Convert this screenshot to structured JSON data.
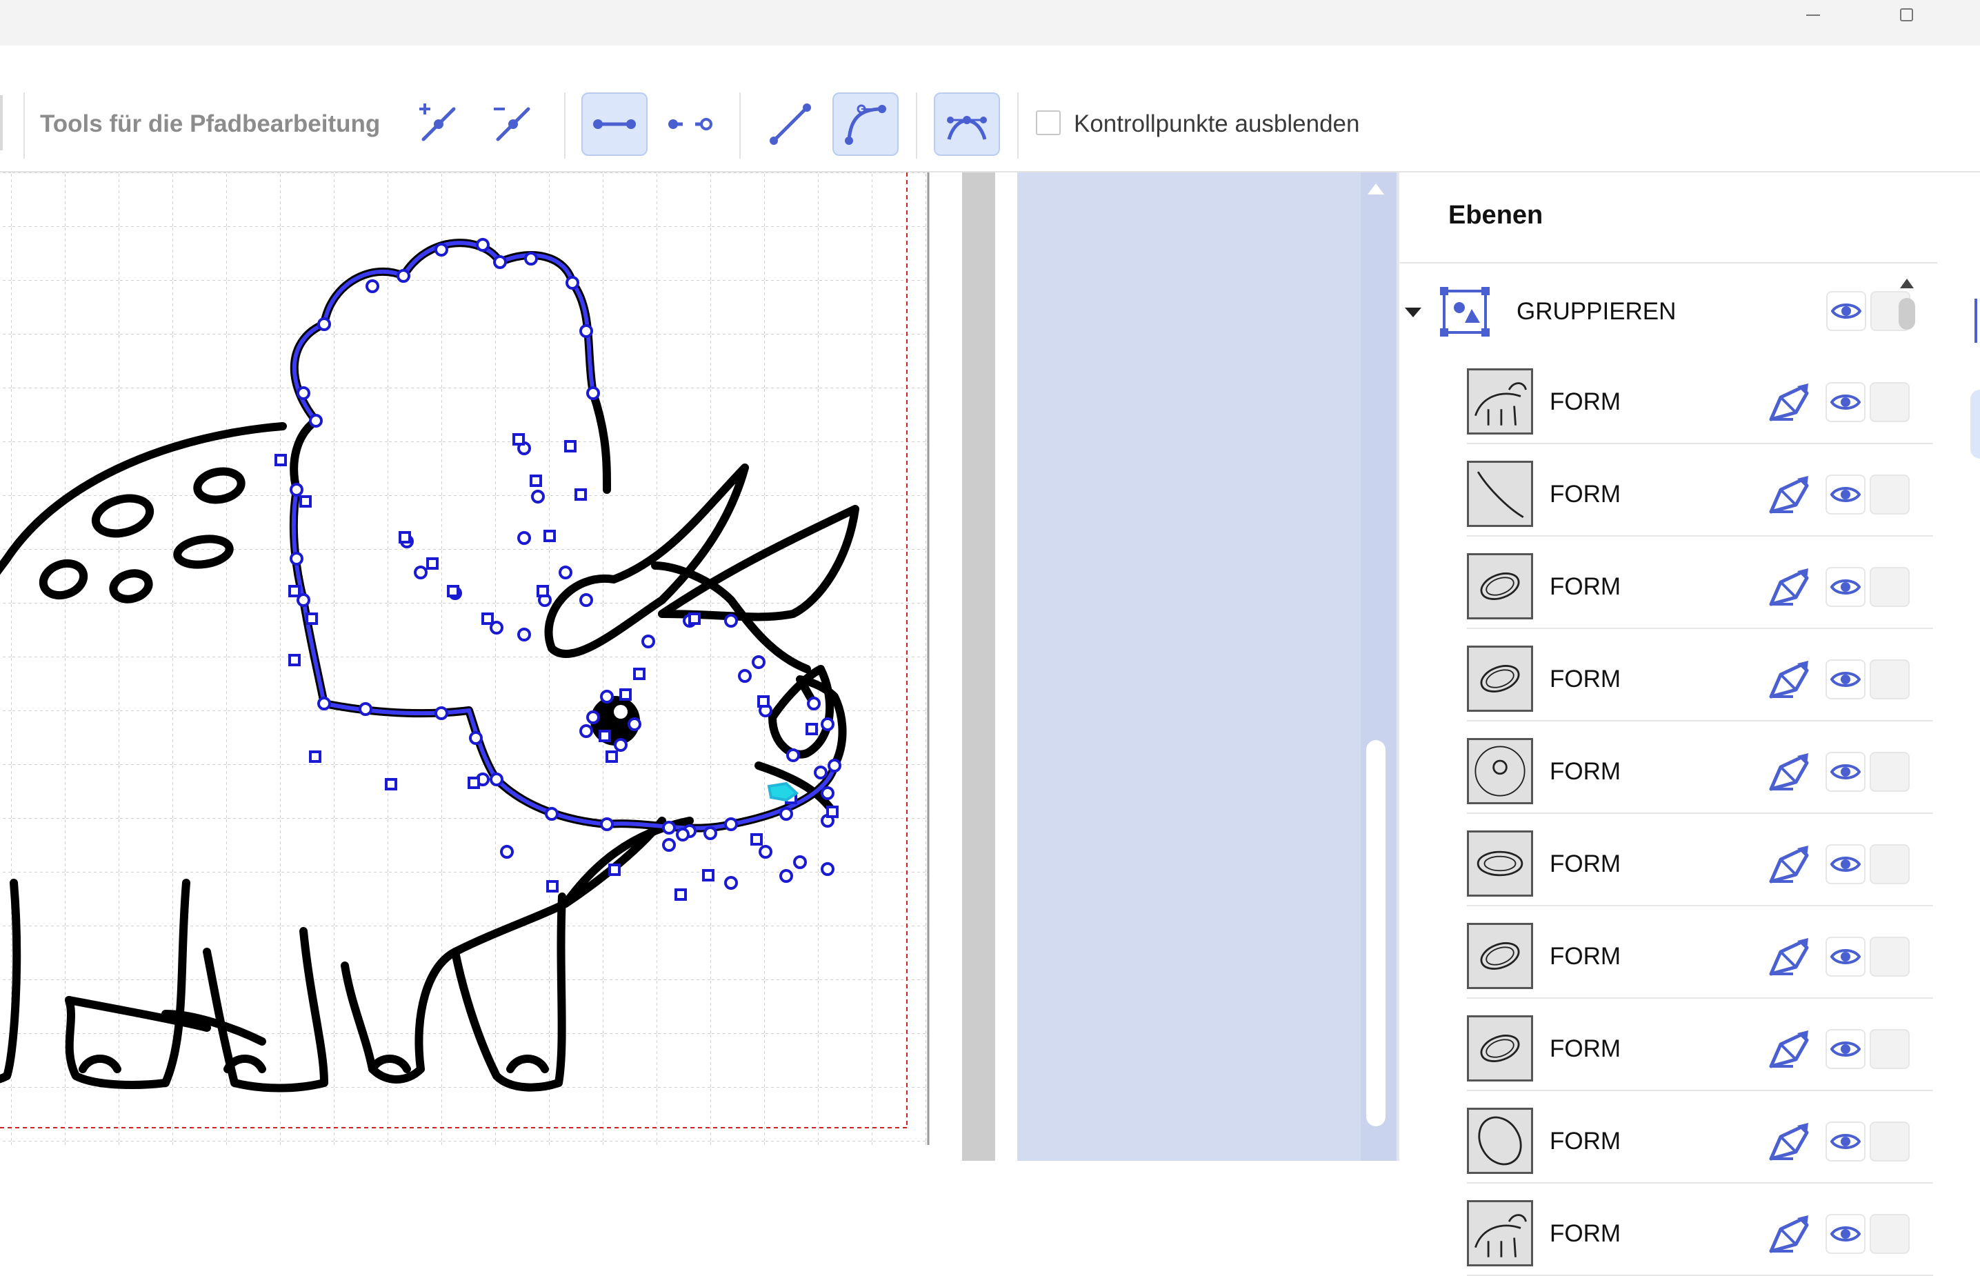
{
  "toolbar": {
    "title": "Tools für die Pfadbearbeitung",
    "tools": [
      {
        "name": "add-node",
        "icon": "add-node-icon",
        "active": false
      },
      {
        "name": "remove-node",
        "icon": "remove-node-icon",
        "active": false
      },
      {
        "name": "join-nodes",
        "icon": "join-nodes-icon",
        "active": true
      },
      {
        "name": "break-nodes",
        "icon": "break-nodes-icon",
        "active": false
      },
      {
        "name": "straight-segment",
        "icon": "straight-segment-icon",
        "active": false
      },
      {
        "name": "curve-segment",
        "icon": "curve-segment-icon",
        "active": true
      },
      {
        "name": "smooth-node",
        "icon": "smooth-node-icon",
        "active": true
      }
    ],
    "hide_controls_checkbox": {
      "label": "Kontrollpunkte ausblenden",
      "checked": false
    }
  },
  "layers": {
    "title": "Ebenen",
    "group": {
      "label": "GRUPPIEREN",
      "expanded": true,
      "icon": "group-icon"
    },
    "items": [
      {
        "label": "FORM",
        "thumb": "triceratops"
      },
      {
        "label": "FORM",
        "thumb": "line"
      },
      {
        "label": "FORM",
        "thumb": "ellipse-tilted"
      },
      {
        "label": "FORM",
        "thumb": "ellipse-tilted"
      },
      {
        "label": "FORM",
        "thumb": "circle-small"
      },
      {
        "label": "FORM",
        "thumb": "ellipse-wide"
      },
      {
        "label": "FORM",
        "thumb": "ellipse-tilted"
      },
      {
        "label": "FORM",
        "thumb": "ellipse-tilted"
      },
      {
        "label": "FORM",
        "thumb": "ellipse-big"
      },
      {
        "label": "FORM",
        "thumb": "triceratops"
      }
    ]
  },
  "colors": {
    "accent": "#4a5fd0",
    "selection_blue": "#1a1ad0",
    "pane_blue": "#d3dbf0",
    "active_tool_bg": "#dbe6fb"
  }
}
